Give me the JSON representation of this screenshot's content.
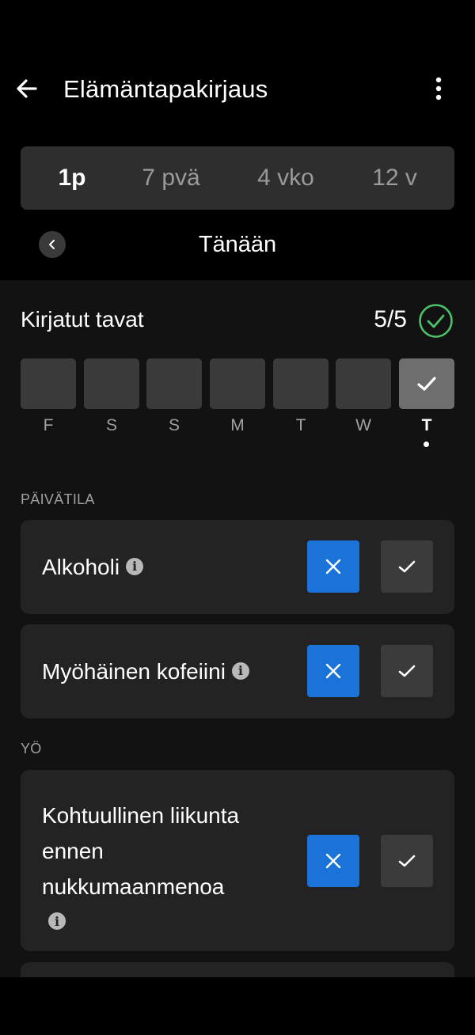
{
  "header": {
    "title": "Elämäntapakirjaus",
    "back_icon": "arrow-left-icon",
    "more_icon": "more-vertical-icon"
  },
  "period_tabs": [
    {
      "label": "1p",
      "active": true
    },
    {
      "label": "7 pvä",
      "active": false
    },
    {
      "label": "4 vko",
      "active": false
    },
    {
      "label": "12 v",
      "active": false
    }
  ],
  "date_nav": {
    "label": "Tänään",
    "prev_icon": "chevron-left-icon"
  },
  "logged": {
    "title": "Kirjatut tavat",
    "count": "5/5",
    "status_icon": "check-circle-icon",
    "days": [
      {
        "label": "F",
        "checked": false
      },
      {
        "label": "S",
        "checked": false
      },
      {
        "label": "S",
        "checked": false
      },
      {
        "label": "M",
        "checked": false
      },
      {
        "label": "T",
        "checked": false
      },
      {
        "label": "W",
        "checked": false
      },
      {
        "label": "T",
        "checked": true,
        "today": true
      }
    ]
  },
  "sections": [
    {
      "title": "PÄIVÄTILA",
      "items": [
        {
          "label": "Alkoholi",
          "selected": "no"
        },
        {
          "label": "Myöhäinen kofeiini",
          "selected": "no"
        }
      ]
    },
    {
      "title": "YÖ",
      "items": [
        {
          "label_lines": [
            "Kohtuullinen liikunta",
            "ennen",
            "nukkumaanmenoa"
          ],
          "selected": "no"
        }
      ]
    }
  ],
  "colors": {
    "accent_blue": "#1b73d9",
    "success_green": "#4cc36a",
    "card_bg": "#232323",
    "content_bg": "#121212"
  }
}
